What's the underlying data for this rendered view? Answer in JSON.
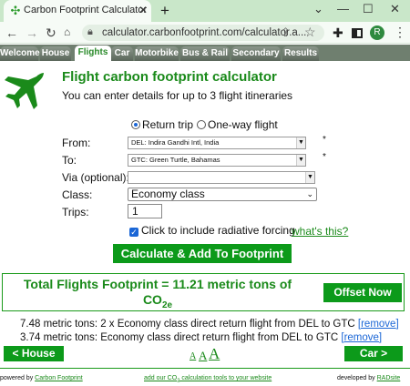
{
  "browser": {
    "tab_title": "Carbon Footprint Calculator",
    "url": "calculator.carbonfootprint.com/calculator.a...",
    "avatar": "R",
    "icons": {
      "favicon": "leaf-icon",
      "close": "close-icon",
      "new_tab": "plus-icon",
      "minimize": "minimize-icon",
      "maximize": "maximize-icon",
      "window_close": "close-icon",
      "back": "back-arrow-icon",
      "forward": "forward-arrow-icon",
      "reload": "reload-icon",
      "lock": "lock-icon",
      "share": "share-icon",
      "bookmark": "star-icon",
      "extensions": "puzzle-icon",
      "menu": "kebab-menu-icon"
    }
  },
  "site_tabs": [
    "Welcome",
    "House",
    "Flights",
    "Car",
    "Motorbike",
    "Bus & Rail",
    "Secondary",
    "Results"
  ],
  "active_tab": "Flights",
  "header": {
    "title": "Flight carbon footprint calculator",
    "subtitle": "You can enter details for up to 3 flight itineraries",
    "icon": "airplane-icon"
  },
  "form": {
    "trip_type": {
      "options": [
        "Return trip",
        "One-way flight"
      ],
      "selected": "Return trip"
    },
    "from_label": "From:",
    "from_value": "DEL: Indira Gandhi Intl, India",
    "to_label": "To:",
    "to_value": "GTC: Green Turtle, Bahamas",
    "via_label": "Via (optional):",
    "via_value": "",
    "required_mark": "*",
    "class_label": "Class:",
    "class_value": "Economy class",
    "trips_label": "Trips:",
    "trips_value": "1",
    "rf_label": "Click to include radiative forcing",
    "rf_checked": true,
    "whatis": "what's this?",
    "calc_button": "Calculate & Add To Footprint"
  },
  "total": {
    "text": "Total Flights Footprint = 11.21 metric tons of",
    "co2": "CO",
    "co2_sub": "2e",
    "offset_button": "Offset Now"
  },
  "flights": [
    {
      "text": "7.48 metric tons: 2 x Economy class direct return flight from DEL to GTC",
      "remove": "[remove]"
    },
    {
      "text": "3.74 metric tons: Economy class direct return flight from DEL to GTC",
      "remove": "[remove]"
    }
  ],
  "nav": {
    "prev": "< House",
    "next": "Car >",
    "font_sizes": [
      "A",
      "A",
      "A"
    ]
  },
  "footer": {
    "powered_prefix": "powered by",
    "powered_link": "Carbon Footprint",
    "middle_a": "add our CO",
    "middle_sub": "2",
    "middle_b": " calculation tools to your website",
    "dev_prefix": "developed by",
    "dev_link": "RADsite"
  },
  "colors": {
    "brand_green": "#0c9a1a",
    "link_blue": "#1a66d6",
    "chrome_green": "#c9e7c9"
  }
}
